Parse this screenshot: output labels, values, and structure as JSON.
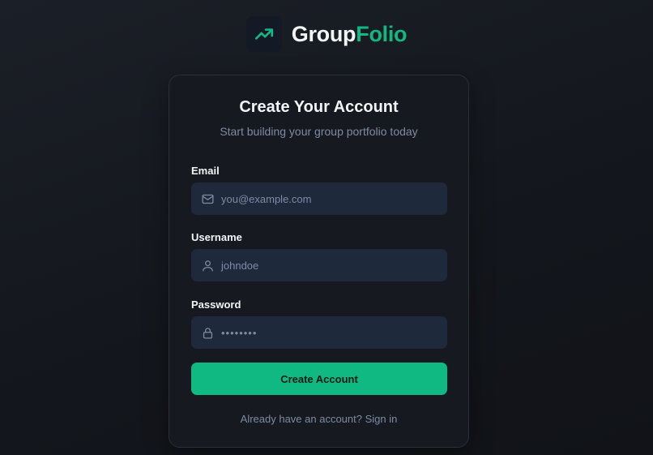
{
  "brand": {
    "name_part1": "Group",
    "name_part2": "Folio",
    "icon": "trending-up-icon",
    "accent_color": "#10b981"
  },
  "card": {
    "title": "Create Your Account",
    "subtitle": "Start building your group portfolio today"
  },
  "form": {
    "email": {
      "label": "Email",
      "placeholder": "you@example.com",
      "icon": "mail-icon"
    },
    "username": {
      "label": "Username",
      "placeholder": "johndoe",
      "icon": "user-icon"
    },
    "password": {
      "label": "Password",
      "placeholder": "••••••••",
      "icon": "lock-icon"
    },
    "submit_label": "Create Account"
  },
  "footer": {
    "signin_text": "Already have an account? Sign in"
  }
}
